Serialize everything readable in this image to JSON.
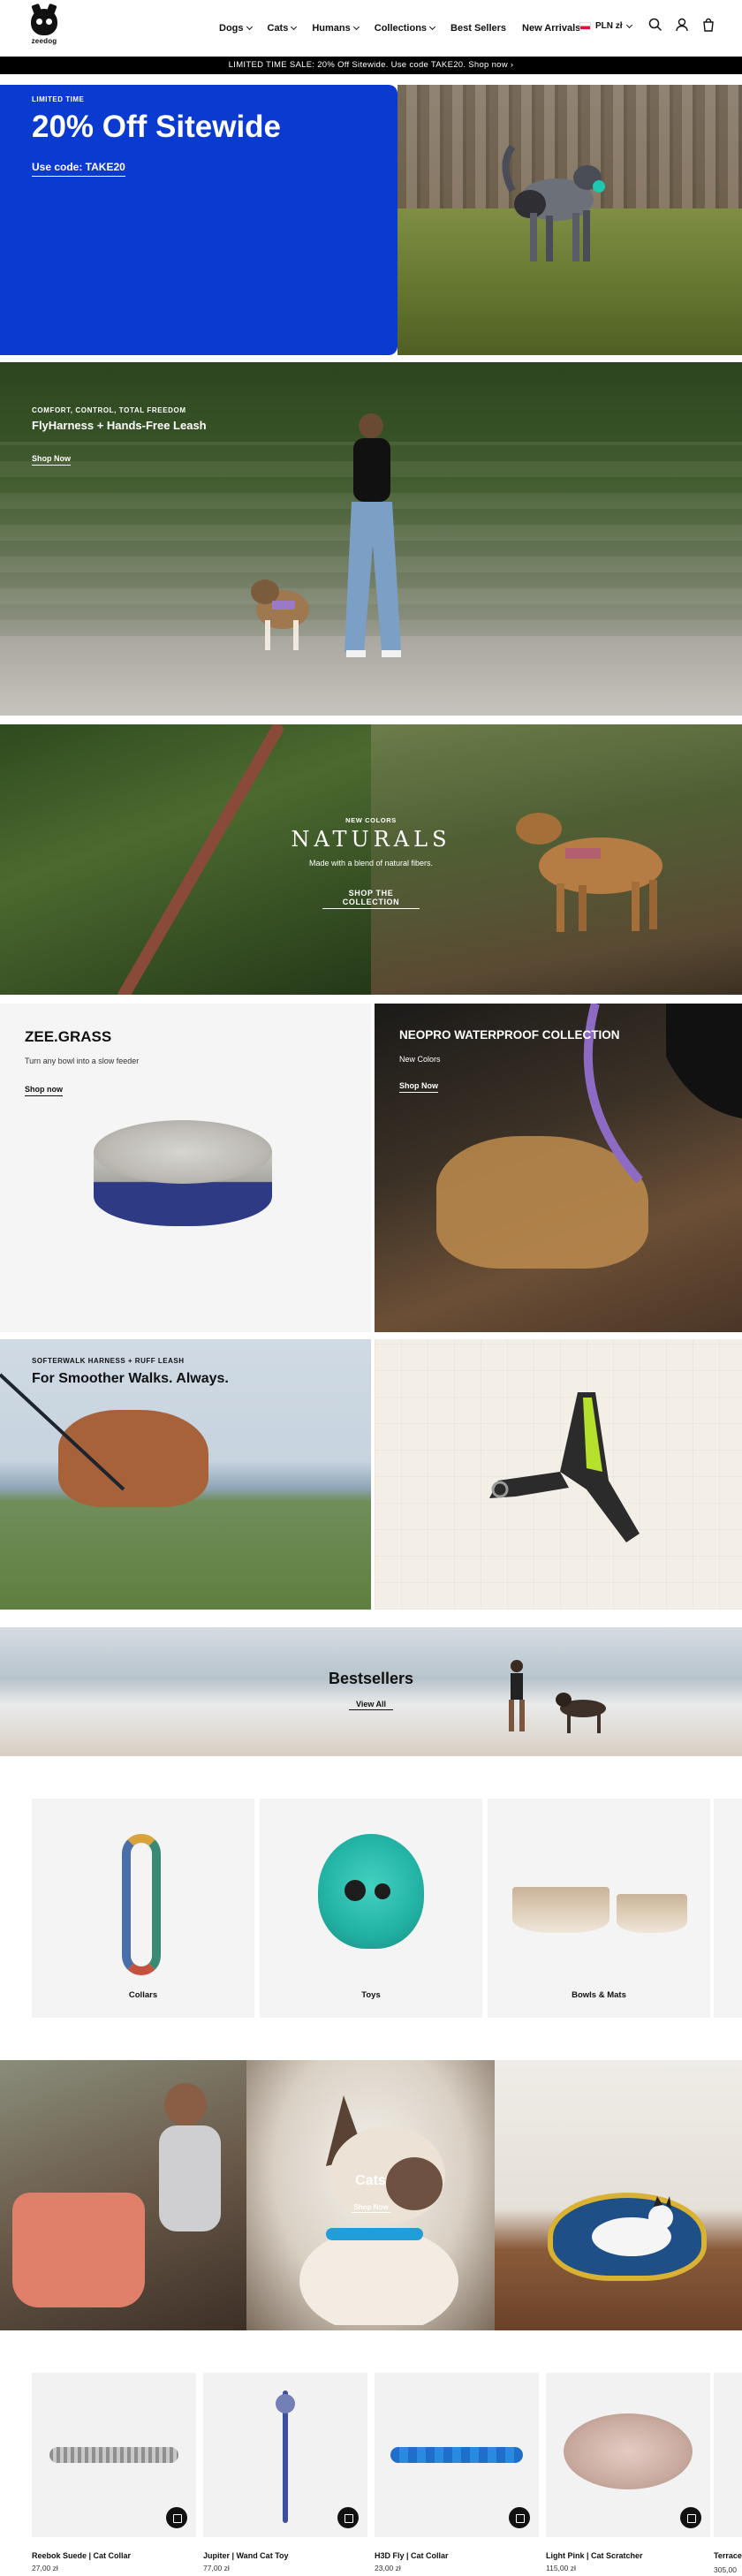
{
  "header": {
    "logo_text": "zeedog",
    "nav": [
      {
        "label": "Dogs",
        "has_dropdown": true
      },
      {
        "label": "Cats",
        "has_dropdown": true
      },
      {
        "label": "Humans",
        "has_dropdown": true
      },
      {
        "label": "Collections",
        "has_dropdown": true
      },
      {
        "label": "Best Sellers",
        "has_dropdown": false
      },
      {
        "label": "New Arrivals",
        "has_dropdown": false
      }
    ],
    "currency": "PLN zł",
    "icons": [
      "search-icon",
      "account-icon",
      "cart-icon"
    ]
  },
  "announcement": "LIMITED TIME SALE: 20% Off Sitewide. Use code TAKE20.  Shop now ›",
  "hero": {
    "eyebrow": "LIMITED TIME",
    "title": "20% Off Sitewide",
    "code_link": "Use code: TAKE20",
    "accent_color": "#0b3ad1"
  },
  "flyharness": {
    "eyebrow": "COMFORT, CONTROL, TOTAL FREEDOM",
    "title": "FlyHarness + Hands-Free Leash",
    "link": "Shop Now"
  },
  "naturals": {
    "eyebrow": "NEW COLORS",
    "title": "NATURALS",
    "subtitle": "Made with a blend of natural fibers.",
    "link": "SHOP THE COLLECTION"
  },
  "zeegrass": {
    "title": "ZEE.GRASS",
    "subtitle": "Turn any bowl into a slow feeder",
    "link": "Shop now"
  },
  "neopro": {
    "title": "NEOPRO WATERPROOF COLLECTION",
    "subtitle": "New Colors",
    "link": "Shop Now"
  },
  "softerwalk": {
    "eyebrow": "SOFTERWALK HARNESS + RUFF LEASH",
    "title": "For Smoother Walks. Always."
  },
  "bestsellers": {
    "title": "Bestsellers",
    "link": "View All"
  },
  "categories": [
    {
      "label": "Collars"
    },
    {
      "label": "Toys"
    },
    {
      "label": "Bowls & Mats"
    }
  ],
  "cats_banner": {
    "title": "Cats",
    "link": "Shop Now"
  },
  "products": [
    {
      "name": "Reebok Suede | Cat Collar",
      "price": "27,00 zł"
    },
    {
      "name": "Jupiter | Wand Cat Toy",
      "price": "77,00 zł"
    },
    {
      "name": "H3D Fly | Cat Collar",
      "price": "23,00 zł"
    },
    {
      "name": "Light Pink | Cat Scratcher",
      "price": "115,00 zł"
    }
  ],
  "products_partial": {
    "name": "Terrace",
    "price": "305,00"
  }
}
